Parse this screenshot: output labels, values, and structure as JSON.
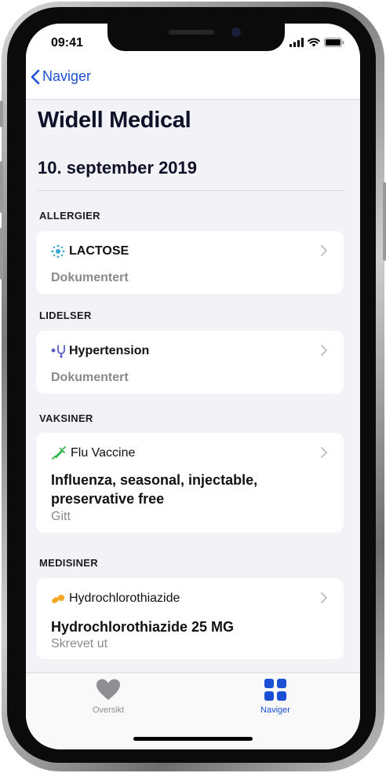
{
  "status": {
    "time": "09:41"
  },
  "nav": {
    "back_label": "Naviger"
  },
  "header": {
    "title": "Widell Medical",
    "date": "10. september 2019"
  },
  "sections": {
    "allergies": {
      "title": "ALLERGIER",
      "card": {
        "name": "LACTOSE",
        "status": "Dokumentert",
        "icon": "allergy-icon"
      }
    },
    "conditions": {
      "title": "LIDELSER",
      "card": {
        "name": "Hypertension",
        "status": "Dokumentert",
        "icon": "stethoscope-icon"
      }
    },
    "vaccines": {
      "title": "VAKSINER",
      "card": {
        "name": "Flu Vaccine",
        "detail": "Influenza, seasonal, injectable, preservative free",
        "status": "Gitt",
        "icon": "syringe-icon"
      }
    },
    "medications": {
      "title": "MEDISINER",
      "card": {
        "name": "Hydrochlorothiazide",
        "detail": "Hydrochlorothiazide 25 MG",
        "status": "Skrevet ut",
        "icon": "pills-icon"
      }
    }
  },
  "tabbar": {
    "tabs": [
      {
        "label": "Oversikt",
        "icon": "heart-icon",
        "active": false
      },
      {
        "label": "Naviger",
        "icon": "grid-icon",
        "active": true
      }
    ]
  },
  "colors": {
    "accent": "#1a4fd6",
    "background": "#f2f2f7",
    "inactive": "#8e8e93"
  }
}
